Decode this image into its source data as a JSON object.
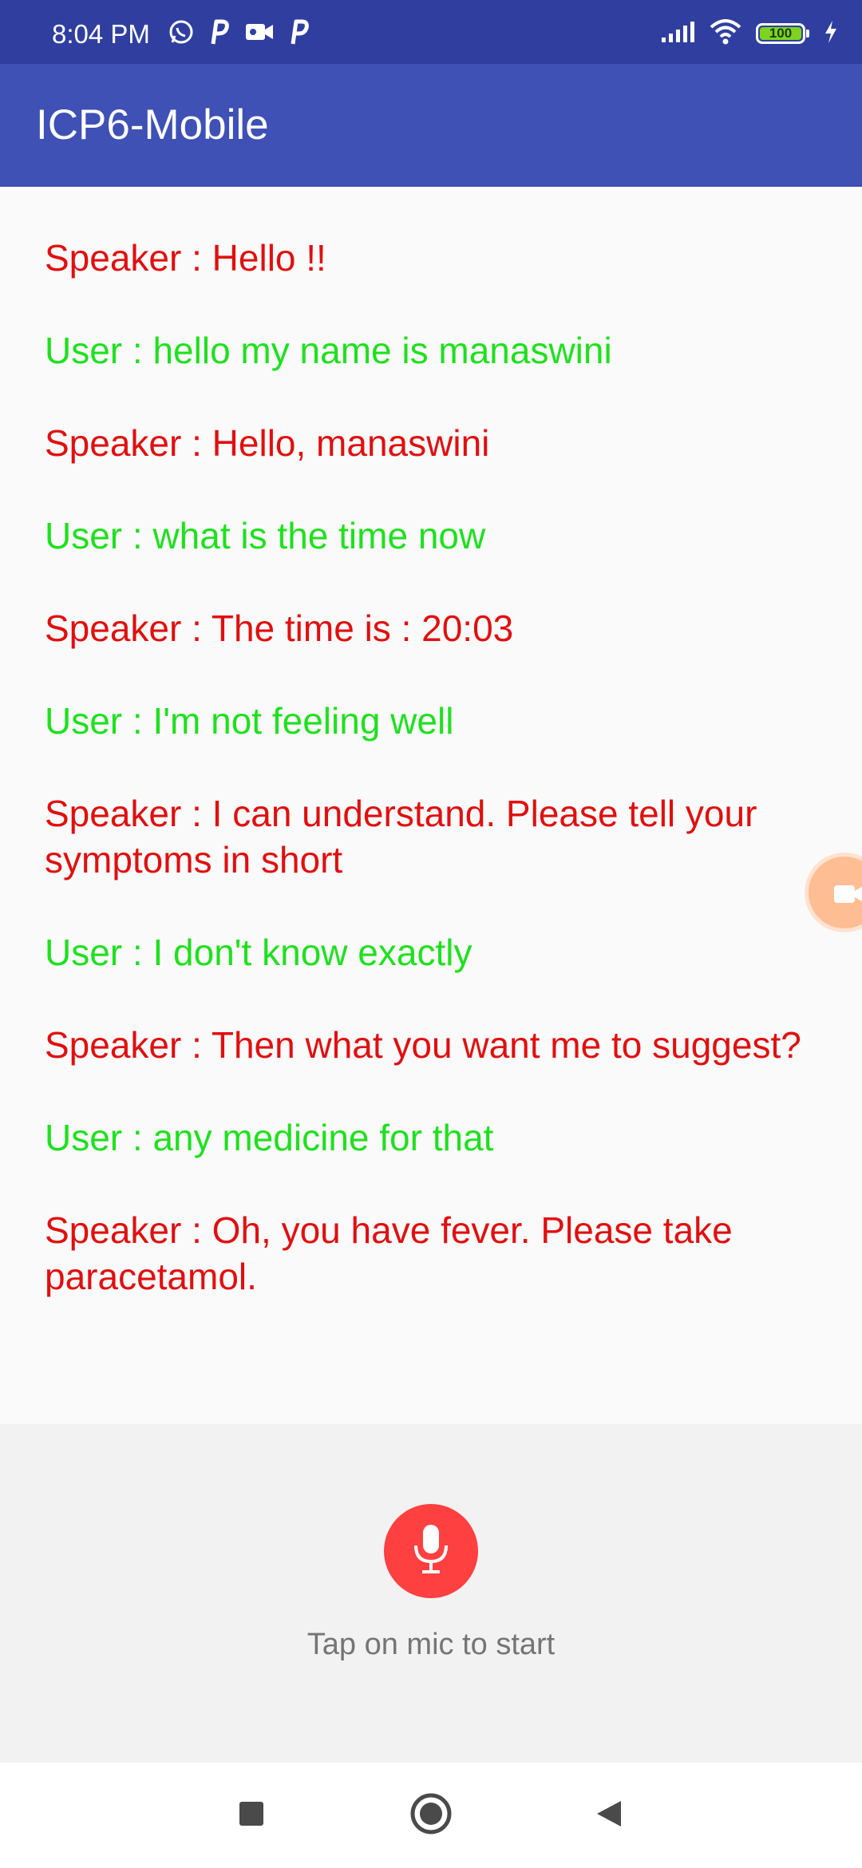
{
  "status_bar": {
    "time": "8:04 PM",
    "left_icons": [
      "whatsapp-icon",
      "p-notification-icon",
      "video-camera-icon",
      "p-notification-icon"
    ],
    "right_icons": [
      "signal-icon",
      "wifi-icon",
      "battery-icon",
      "charging-icon"
    ],
    "battery_level": "100",
    "battery_fraction": 1.0,
    "color": "#303F9F"
  },
  "app_bar": {
    "title": "ICP6-Mobile",
    "color": "#3F51B5"
  },
  "conversation": {
    "speaker_color": "#e00f0f",
    "user_color": "#1fe01f",
    "messages": [
      {
        "role": "speaker",
        "text": "Speaker : Hello !!"
      },
      {
        "role": "user",
        "text": "User : hello my name is manaswini"
      },
      {
        "role": "speaker",
        "text": "Speaker : Hello, manaswini"
      },
      {
        "role": "user",
        "text": "User : what is the time now"
      },
      {
        "role": "speaker",
        "text": "Speaker : The time is : 20:03"
      },
      {
        "role": "user",
        "text": "User : I'm not feeling well"
      },
      {
        "role": "speaker",
        "text": "Speaker : I can understand. Please tell your symptoms in short"
      },
      {
        "role": "user",
        "text": "User : I don't know exactly"
      },
      {
        "role": "speaker",
        "text": "Speaker : Then what you want me to suggest?"
      },
      {
        "role": "user",
        "text": "User : any medicine for that"
      },
      {
        "role": "speaker",
        "text": "Speaker : Oh, you have fever. Please take paracetamol."
      }
    ]
  },
  "floating_bubble": {
    "icon": "screen-record-icon"
  },
  "bottom_panel": {
    "mic_icon": "microphone-icon",
    "mic_color": "#ff4040",
    "hint": "Tap on mic to start"
  },
  "nav_bar": {
    "items": [
      "recent-apps-icon",
      "home-icon",
      "back-icon"
    ]
  }
}
